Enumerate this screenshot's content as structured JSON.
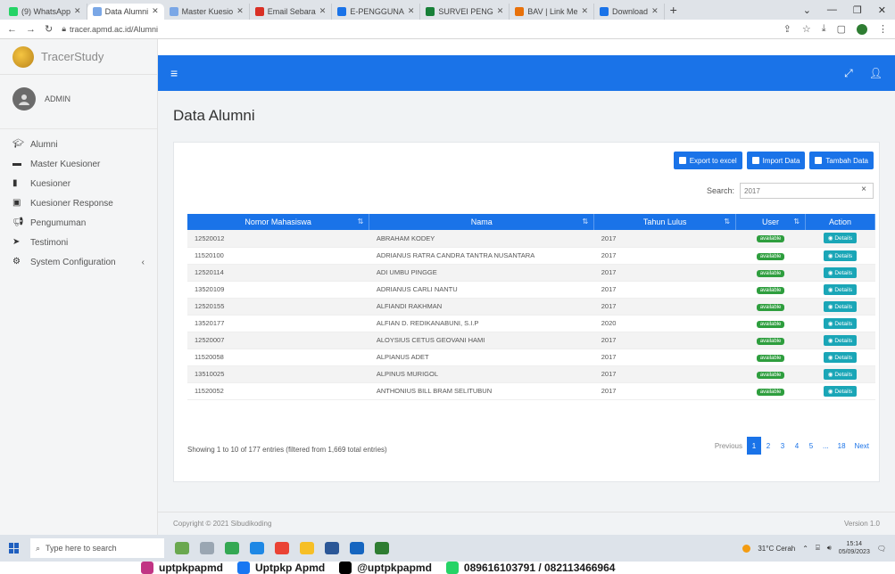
{
  "browser": {
    "tabs": [
      {
        "label": "(9) WhatsApp",
        "color": "#25d366"
      },
      {
        "label": "Data Alumni",
        "color": "#7aa7e6",
        "active": true
      },
      {
        "label": "Master Kuesio",
        "color": "#7aa7e6"
      },
      {
        "label": "Email Sebara",
        "color": "#d93025"
      },
      {
        "label": "E-PENGGUNA",
        "color": "#1a73e8"
      },
      {
        "label": "SURVEI PENG",
        "color": "#188038"
      },
      {
        "label": "BAV | Link Me",
        "color": "#e8710a"
      },
      {
        "label": "Download",
        "color": "#1a73e8"
      }
    ],
    "url": "tracer.apmd.ac.id/Alumni"
  },
  "sidebar": {
    "brand": "TracerStudy",
    "user": "ADMIN",
    "items": [
      {
        "label": "Alumni",
        "icon": "graduation-cap-icon"
      },
      {
        "label": "Master Kuesioner",
        "icon": "folder-icon"
      },
      {
        "label": "Kuesioner",
        "icon": "file-icon"
      },
      {
        "label": "Kuesioner Response",
        "icon": "file-check-icon"
      },
      {
        "label": "Pengumuman",
        "icon": "megaphone-icon"
      },
      {
        "label": "Testimoni",
        "icon": "paper-plane-icon"
      },
      {
        "label": "System Configuration",
        "icon": "gears-icon",
        "chevron": "‹"
      }
    ]
  },
  "page": {
    "title": "Data Alumni",
    "buttons": {
      "export": "Export to excel",
      "import": "Import Data",
      "add": "Tambah Data"
    },
    "search_label": "Search:",
    "search_value": "2017"
  },
  "table": {
    "headers": [
      "Nomor Mahasiswa",
      "Nama",
      "Tahun Lulus",
      "User",
      "Action"
    ],
    "rows": [
      {
        "nim": "12520012",
        "nama": "ABRAHAM KODEY",
        "tahun": "2017"
      },
      {
        "nim": "11520100",
        "nama": "ADRIANUS RATRA CANDRA TANTRA NUSANTARA",
        "tahun": "2017"
      },
      {
        "nim": "12520114",
        "nama": "ADI UMBU PINGGE",
        "tahun": "2017"
      },
      {
        "nim": "13520109",
        "nama": "ADRIANUS CARLI NANTU",
        "tahun": "2017"
      },
      {
        "nim": "12520155",
        "nama": "ALFIANDI RAKHMAN",
        "tahun": "2017"
      },
      {
        "nim": "13520177",
        "nama": "ALFIAN D. REDIKANABUNI, S.I.P",
        "tahun": "2020"
      },
      {
        "nim": "12520007",
        "nama": "ALOYSIUS CETUS GEOVANI HAMI",
        "tahun": "2017"
      },
      {
        "nim": "11520058",
        "nama": "ALPIANUS ADET",
        "tahun": "2017"
      },
      {
        "nim": "13510025",
        "nama": "ALPINUS MURIGOL",
        "tahun": "2017"
      },
      {
        "nim": "11520052",
        "nama": "ANTHONIUS BILL BRAM SELITUBUN",
        "tahun": "2017"
      }
    ],
    "badge_label": "available",
    "action_label": "Details",
    "info": "Showing 1 to 10 of 177 entries (filtered from 1,669 total entries)",
    "pagination": [
      "Previous",
      "1",
      "2",
      "3",
      "4",
      "5",
      "...",
      "18",
      "Next"
    ]
  },
  "footer": {
    "copyright": "Copyright © 2021 Sibudikoding",
    "version": "Version 1.0"
  },
  "taskbar": {
    "search_placeholder": "Type here to search",
    "weather": "31°C Cerah",
    "time": "15:14",
    "date": "05/09/2023"
  },
  "watermark": {
    "items": [
      "uptpkpapmd",
      "Uptpkp Apmd",
      "@uptpkpapmd",
      "089616103791 / 082113466964"
    ]
  }
}
